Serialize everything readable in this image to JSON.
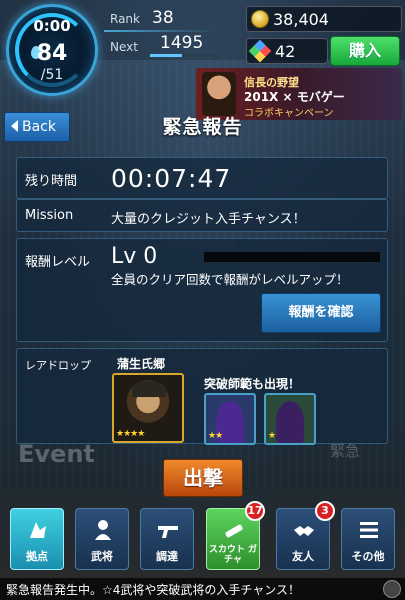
{
  "hud": {
    "stamina_timer": "0:00",
    "stamina_current": "84",
    "stamina_max": "/51",
    "rank_label": "Rank",
    "rank_value": "38",
    "next_label": "Next",
    "next_value": "1495",
    "next_progress": 0.45,
    "gold": "38,404",
    "gems": "42",
    "buy_label": "購入"
  },
  "banner": {
    "line1": "信長の野望",
    "line2": "201X × モバゲー",
    "line3": "コラボキャンペーン"
  },
  "header": {
    "back_label": "Back",
    "title": "緊急報告"
  },
  "info": {
    "time_label": "残り時間",
    "time_value": "00:07:47",
    "mission_label": "Mission",
    "mission_value": "大量のクレジット入手チャンス！",
    "reward_label": "報酬レベル",
    "reward_level": "Lv 0",
    "reward_progress": 0,
    "reward_desc": "全員のクリア回数で報酬がレベルアップ！",
    "confirm_label": "報酬を確認"
  },
  "rare_drop": {
    "label": "レアドロップ",
    "main_name": "蒲生氏郷",
    "main_stars": "★★★★",
    "appear_text": "突破師範も出現！",
    "sil_a_stars": "★★",
    "sil_b_stars": "★"
  },
  "background": {
    "event_text": "Event",
    "emergency_text": "緊急"
  },
  "sortie_label": "出撃",
  "nav": {
    "items": [
      {
        "label": "拠点"
      },
      {
        "label": "武将"
      },
      {
        "label": "調達"
      },
      {
        "label": "スカウト ガチャ",
        "badge": "17"
      },
      {
        "label": "友人",
        "badge": "3"
      },
      {
        "label": "その他"
      }
    ]
  },
  "ticker": "緊急報告発生中。☆4武将や突破武将の入手チャンス！"
}
